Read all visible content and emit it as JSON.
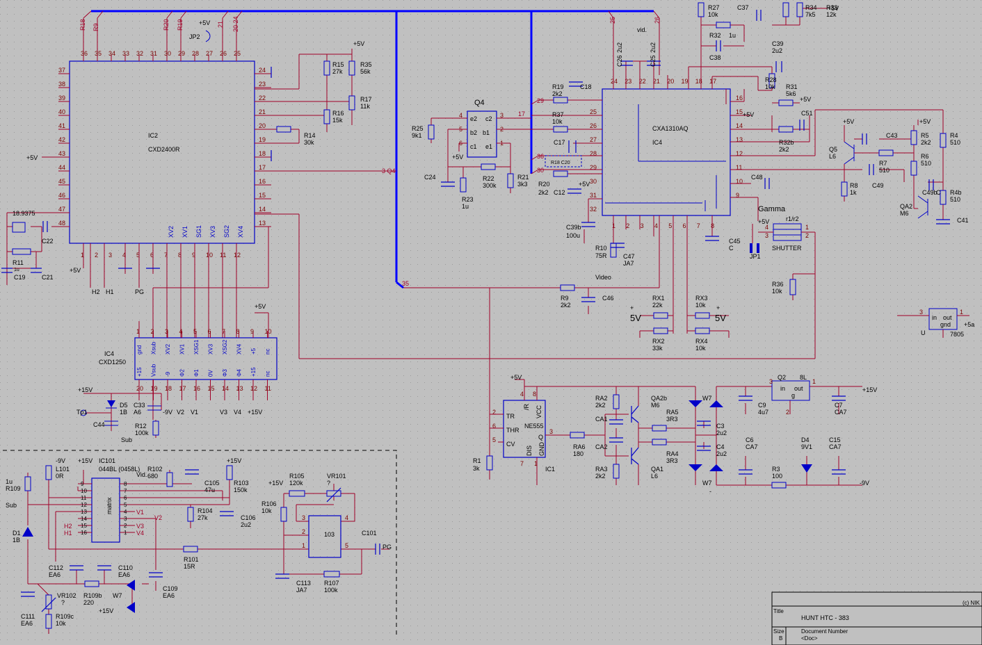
{
  "colors": {
    "background": "#c0c0c0",
    "grid_dot": "#9a9a9a",
    "component": "#0000c8",
    "wire": "#a00028",
    "bus": "#0000ff",
    "label": "#000000",
    "pin_number": "#7a0000",
    "net_label": "#a00028"
  },
  "title_block": {
    "copyright": "(c) NIK",
    "title_label": "Title",
    "title": "HUNT  HTC - 383",
    "size_label": "Size",
    "size": "B",
    "docnum_label": "Document Number",
    "docnum": "<Doc>"
  },
  "ic2": {
    "name": "IC2",
    "part": "CXD2400R",
    "top_pins": [
      "36",
      "35",
      "34",
      "33",
      "32",
      "31",
      "30",
      "29",
      "28",
      "27",
      "26",
      "25"
    ],
    "left_pins": [
      "37",
      "38",
      "39",
      "40",
      "41",
      "42",
      "43",
      "44",
      "45",
      "46",
      "47",
      "48"
    ],
    "right_pins": [
      "24",
      "23",
      "22",
      "21",
      "20",
      "19",
      "18",
      "17",
      "16",
      "15",
      "14",
      "13"
    ],
    "bottom_pins": [
      "1",
      "2",
      "3",
      "4",
      "5",
      "6",
      "7",
      "8",
      "9",
      "10",
      "11",
      "12"
    ],
    "bottom_labels": [
      "XV2",
      "XV1",
      "SG1",
      "XV3",
      "SG2",
      "XV4"
    ]
  },
  "ic4a": {
    "name": "IC4",
    "part": "CXA1310AQ",
    "left_pins": [
      "25",
      "26",
      "27",
      "28",
      "29",
      "30",
      "31",
      "32"
    ],
    "right_pins": [
      "16",
      "15",
      "14",
      "13",
      "12",
      "11",
      "10",
      "9"
    ],
    "top_pins": [
      "24",
      "23",
      "22",
      "21",
      "20",
      "19",
      "18",
      "17"
    ],
    "bottom_pins": [
      "1",
      "2",
      "3",
      "4",
      "5",
      "6",
      "7",
      "8"
    ]
  },
  "ic4b": {
    "name": "IC4",
    "part": "CXD1250",
    "top_pins": [
      "1",
      "2",
      "3",
      "4",
      "5",
      "6",
      "7",
      "8",
      "9",
      "10"
    ],
    "bottom_pins": [
      "20",
      "19",
      "18",
      "17",
      "16",
      "15",
      "14",
      "13",
      "12",
      "11"
    ],
    "top_labels": [
      "gnd",
      "Xsub",
      "XV2",
      "XV1",
      "XSG1",
      "XV3",
      "XSG2",
      "XV4",
      "+5",
      "nc"
    ],
    "bottom_labels": [
      "+15",
      "Vsub",
      "-9",
      "Φ2",
      "Φ1",
      "0V",
      "Φ3",
      "Φ4",
      "+15",
      "nc"
    ]
  },
  "ic1": {
    "name": "IC1",
    "part": "NE555",
    "pins_left": [
      "TR",
      "THR",
      "CV"
    ],
    "pins_right": [
      "/R",
      "VCC",
      "Q",
      "GND",
      "DIS"
    ],
    "pin_numbers": [
      "2",
      "6",
      "5",
      "4",
      "8",
      "3",
      "1",
      "7"
    ]
  },
  "ic101": {
    "name": "IC101",
    "part": "044BL (0458L)",
    "inner": "matrix",
    "left_pins": [
      "9",
      "10",
      "11",
      "12",
      "13",
      "14",
      "15",
      "16"
    ],
    "right_pins": [
      "8",
      "7",
      "6",
      "5",
      "4",
      "3",
      "2",
      "1"
    ],
    "right_labels": [
      "Vid.",
      "",
      "",
      "",
      "V1",
      "V3",
      "V2",
      "V4"
    ],
    "left_labels": [
      "",
      "",
      "",
      "",
      "",
      "H2",
      "H1",
      ""
    ]
  },
  "q4": {
    "name": "Q4",
    "pins": [
      "e2",
      "c2",
      "b2",
      "b1",
      "c1",
      "e1"
    ],
    "pin_numbers": [
      "4",
      "5",
      "6",
      "3",
      "2",
      "1"
    ]
  },
  "ic103": {
    "name": "103",
    "pins": [
      "3",
      "4",
      "2",
      "1",
      "5"
    ]
  },
  "q2": {
    "name": "Q2",
    "part": "8L",
    "in": "in",
    "out": "out",
    "gnd": "g",
    "pins": [
      "3",
      "1",
      "2"
    ]
  },
  "u7805": {
    "name": "U",
    "part": "7805",
    "in": "in",
    "out": "out",
    "gnd": "gnd",
    "pins": [
      "3",
      "1",
      "2"
    ],
    "rail": "+5a"
  },
  "gamma": {
    "title": "Gamma",
    "switch": "r1/r2",
    "name": "SHUTTER",
    "pins": [
      "4",
      "3",
      "1",
      "2"
    ]
  },
  "net_labels": {
    "plus5v": "+5V",
    "plus15v": "+15V",
    "minus9v": "-9V",
    "sub": "Sub",
    "pg": "PG",
    "h1": "H1",
    "h2": "H2",
    "v1": "V1",
    "v2": "V2",
    "v3": "V3",
    "v4": "V4",
    "vid": "vid.",
    "video": "Video",
    "tp1": "Tp1",
    "five_v": "5V",
    "minus": "-",
    "bus_nets": [
      "R18",
      "R9",
      "R20",
      "R19",
      "21",
      "20 24",
      "25",
      "26",
      "17",
      "29",
      "30",
      "3 Q4",
      "35",
      "36"
    ]
  },
  "components": [
    {
      "ref": "R15",
      "val": "27k"
    },
    {
      "ref": "R35",
      "val": "56k"
    },
    {
      "ref": "R17",
      "val": "11k"
    },
    {
      "ref": "R16",
      "val": "15k"
    },
    {
      "ref": "R14",
      "val": "30k"
    },
    {
      "ref": "R11",
      "val": "1u"
    },
    {
      "ref": "C19",
      "val": ""
    },
    {
      "ref": "C21",
      "val": ""
    },
    {
      "ref": "C22",
      "val": ""
    },
    {
      "ref": "X",
      "val": "18.9375"
    },
    {
      "ref": "JP2",
      "val": ""
    },
    {
      "ref": "R25",
      "val": "9k1"
    },
    {
      "ref": "R22",
      "val": "300k"
    },
    {
      "ref": "R21",
      "val": "3k3"
    },
    {
      "ref": "R23",
      "val": "1u"
    },
    {
      "ref": "C24",
      "val": ""
    },
    {
      "ref": "R19",
      "val": "2k2"
    },
    {
      "ref": "C18",
      "val": ""
    },
    {
      "ref": "R37",
      "val": "10k"
    },
    {
      "ref": "C17",
      "val": ""
    },
    {
      "ref": "R18 C20",
      "val": ""
    },
    {
      "ref": "R20",
      "val": "2k2"
    },
    {
      "ref": "C12",
      "val": ""
    },
    {
      "ref": "C26",
      "val": "2u2"
    },
    {
      "ref": "C25",
      "val": "2u2"
    },
    {
      "ref": "R27",
      "val": "10k"
    },
    {
      "ref": "C37",
      "val": ""
    },
    {
      "ref": "R34",
      "val": "7k5"
    },
    {
      "ref": "R33",
      "val": "12k"
    },
    {
      "ref": "R32",
      "val": "1u"
    },
    {
      "ref": "C38",
      "val": ""
    },
    {
      "ref": "C39",
      "val": "2u2"
    },
    {
      "ref": "R28",
      "val": "10k"
    },
    {
      "ref": "R31",
      "val": "5k6"
    },
    {
      "ref": "C51",
      "val": ""
    },
    {
      "ref": "R32b",
      "val": "2k2"
    },
    {
      "ref": "C48",
      "val": ""
    },
    {
      "ref": "C39b",
      "val": "100u"
    },
    {
      "ref": "R10",
      "val": "75R"
    },
    {
      "ref": "C47",
      "val": "JA7"
    },
    {
      "ref": "C45",
      "val": "C"
    },
    {
      "ref": "Q5",
      "val": "L6"
    },
    {
      "ref": "C43",
      "val": ""
    },
    {
      "ref": "R7",
      "val": "510"
    },
    {
      "ref": "C49",
      "val": ""
    },
    {
      "ref": "R8",
      "val": "1k"
    },
    {
      "ref": "R5",
      "val": "2k2"
    },
    {
      "ref": "R6",
      "val": "510"
    },
    {
      "ref": "R4",
      "val": "510"
    },
    {
      "ref": "R4b",
      "val": "510"
    },
    {
      "ref": "C49b",
      "val": "C"
    },
    {
      "ref": "QA2",
      "val": "M6"
    },
    {
      "ref": "C41",
      "val": ""
    },
    {
      "ref": "JP1",
      "val": ""
    },
    {
      "ref": "R36",
      "val": "10k"
    },
    {
      "ref": "R9",
      "val": "2k2"
    },
    {
      "ref": "C46",
      "val": ""
    },
    {
      "ref": "RX1",
      "val": "22k"
    },
    {
      "ref": "RX2",
      "val": "33k"
    },
    {
      "ref": "RX3",
      "val": "10k"
    },
    {
      "ref": "RX4",
      "val": "10k"
    },
    {
      "ref": "D5",
      "val": "1B"
    },
    {
      "ref": "C33",
      "val": "A6"
    },
    {
      "ref": "C44",
      "val": ""
    },
    {
      "ref": "R12",
      "val": "100k"
    },
    {
      "ref": "R1",
      "val": "3k"
    },
    {
      "ref": "RA6",
      "val": "180"
    },
    {
      "ref": "RA2",
      "val": "2k2"
    },
    {
      "ref": "CA1",
      "val": ""
    },
    {
      "ref": "CA2",
      "val": ""
    },
    {
      "ref": "RA3",
      "val": "2k2"
    },
    {
      "ref": "QA2b",
      "val": "M6"
    },
    {
      "ref": "QA1",
      "val": "L6"
    },
    {
      "ref": "RA5",
      "val": "3R3"
    },
    {
      "ref": "RA4",
      "val": "3R3"
    },
    {
      "ref": "W7",
      "val": ""
    },
    {
      "ref": "C3",
      "val": "2u2"
    },
    {
      "ref": "C4",
      "val": "2u2"
    },
    {
      "ref": "C9",
      "val": "4u7"
    },
    {
      "ref": "C7",
      "val": "CA7"
    },
    {
      "ref": "C6",
      "val": "CA7"
    },
    {
      "ref": "D4",
      "val": "9V1"
    },
    {
      "ref": "C15",
      "val": "CA7"
    },
    {
      "ref": "R3",
      "val": "100"
    },
    {
      "ref": "R109",
      "val": "1u"
    },
    {
      "ref": "D1",
      "val": "1B"
    },
    {
      "ref": "L101",
      "val": "0R"
    },
    {
      "ref": "R102",
      "val": "680"
    },
    {
      "ref": "C105",
      "val": "47u"
    },
    {
      "ref": "R103",
      "val": "150k"
    },
    {
      "ref": "R104",
      "val": "27k"
    },
    {
      "ref": "C106",
      "val": "2u2"
    },
    {
      "ref": "R101",
      "val": "15R"
    },
    {
      "ref": "R105",
      "val": "120k"
    },
    {
      "ref": "VR101",
      "val": "?"
    },
    {
      "ref": "R106",
      "val": "10k"
    },
    {
      "ref": "C101",
      "val": ""
    },
    {
      "ref": "C113",
      "val": "JA7"
    },
    {
      "ref": "R107",
      "val": "100k"
    },
    {
      "ref": "C112",
      "val": "EA6"
    },
    {
      "ref": "C110",
      "val": "EA6"
    },
    {
      "ref": "C109",
      "val": "EA6"
    },
    {
      "ref": "R109b",
      "val": "220"
    },
    {
      "ref": "VR102",
      "val": "?"
    },
    {
      "ref": "C111",
      "val": "EA6"
    },
    {
      "ref": "R109c",
      "val": "10k"
    },
    {
      "ref": "W7b",
      "val": ""
    }
  ]
}
